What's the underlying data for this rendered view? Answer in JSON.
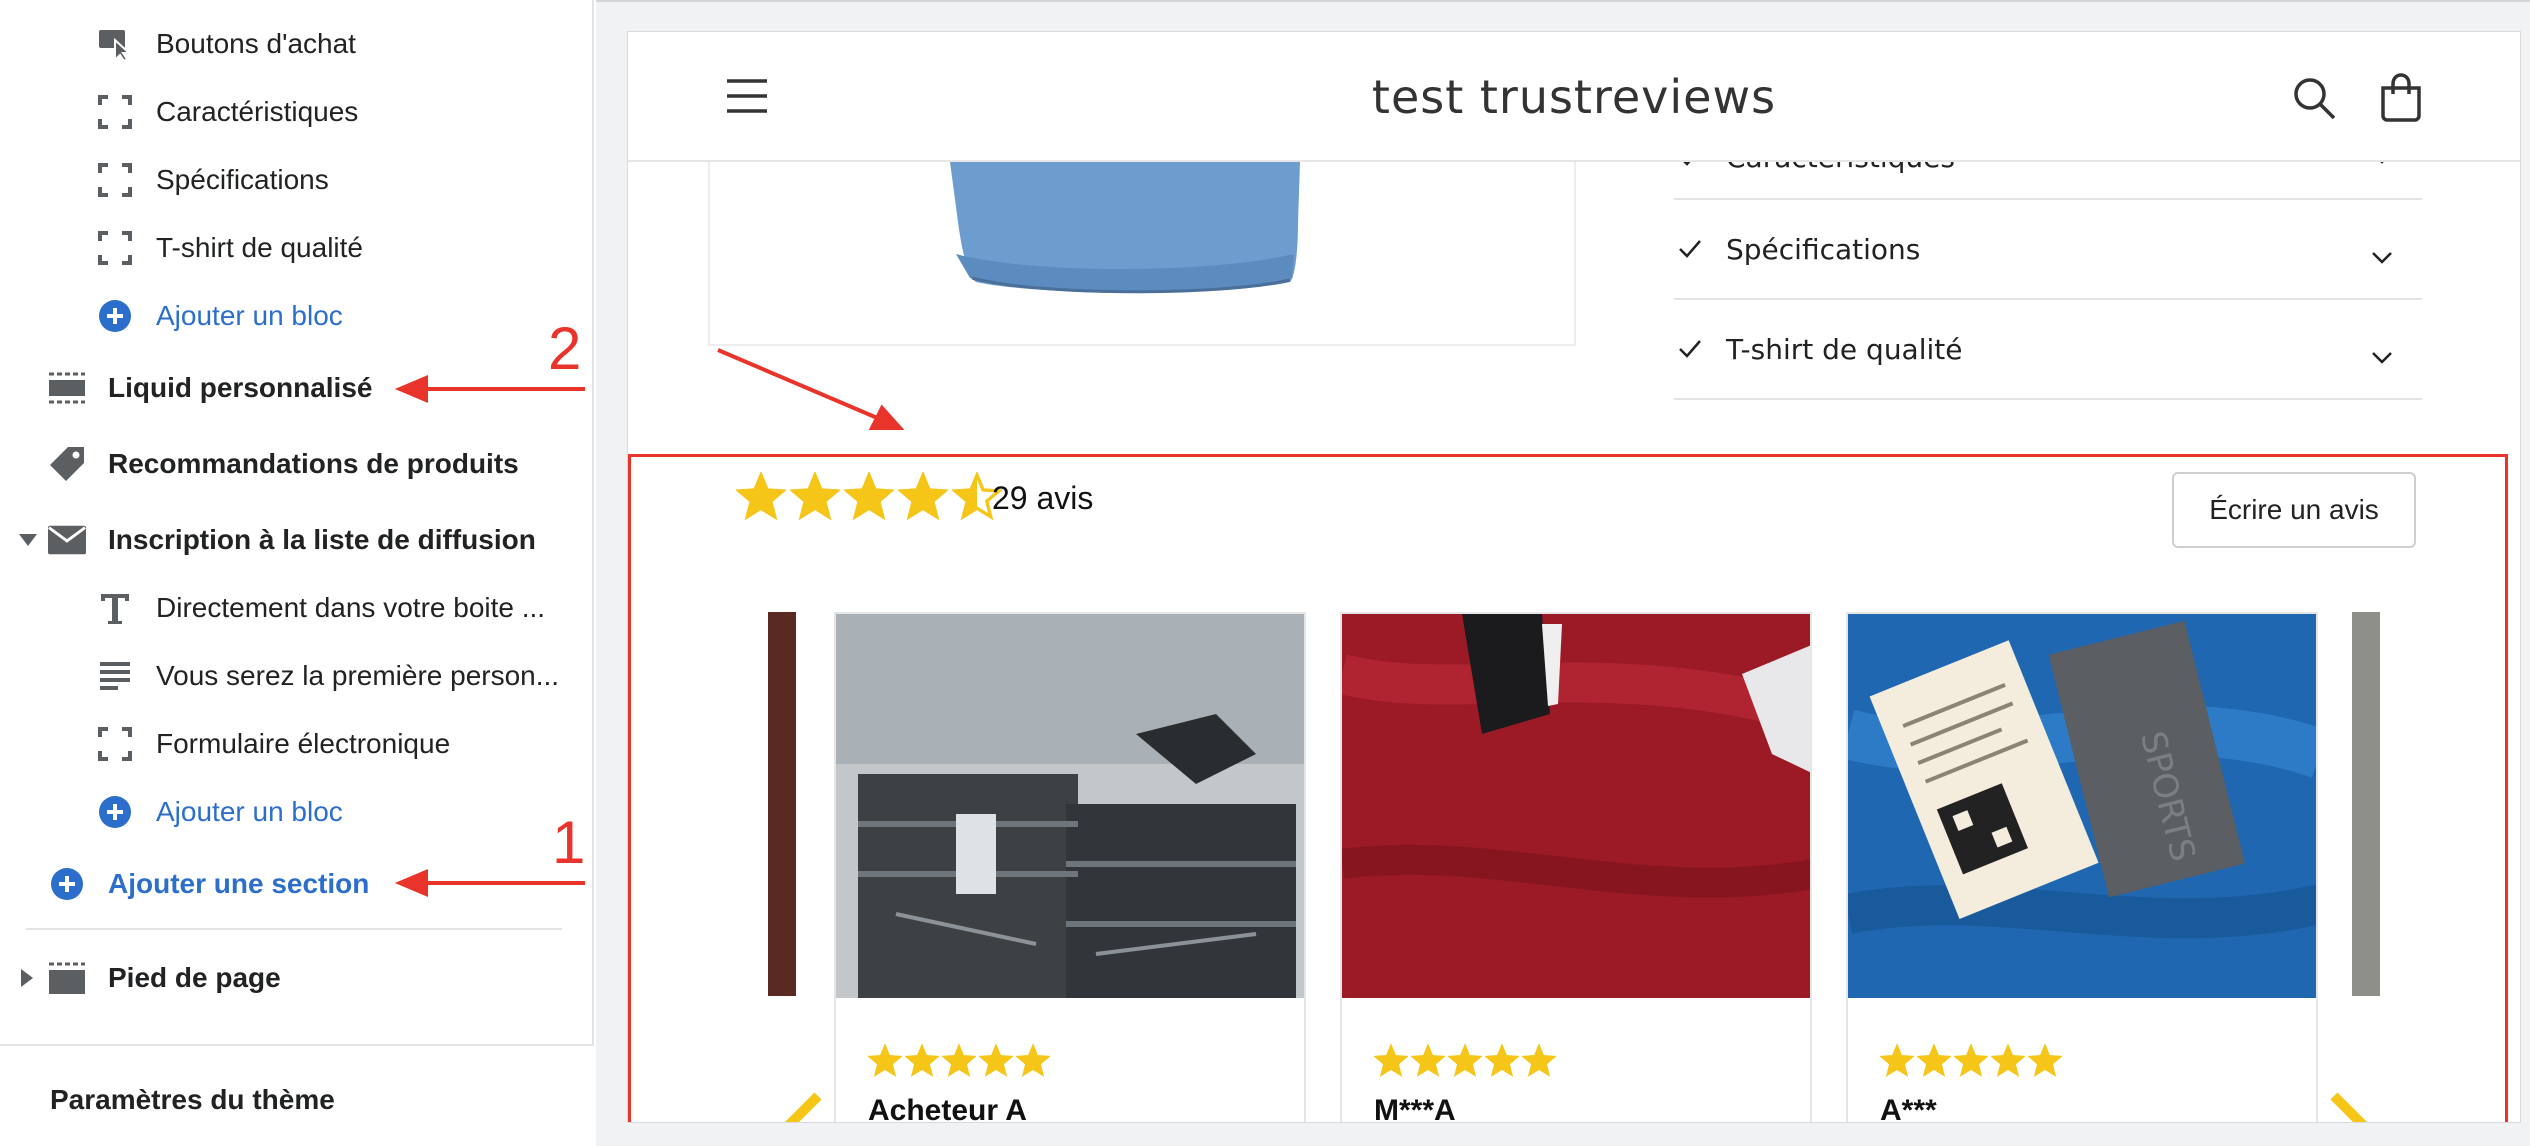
{
  "sidebar": {
    "items": [
      {
        "label": "Boutons d'achat",
        "icon": "cursor-click-icon"
      },
      {
        "label": "Caractéristiques",
        "icon": "dashed-square-icon"
      },
      {
        "label": "Spécifications",
        "icon": "dashed-square-icon"
      },
      {
        "label": "T-shirt de qualité",
        "icon": "dashed-square-icon"
      },
      {
        "label": "Ajouter un bloc",
        "icon": "plus-circle-icon"
      }
    ],
    "sections": [
      {
        "label": "Liquid personnalisé",
        "icon": "section-layout-icon"
      },
      {
        "label": "Recommandations de produits",
        "icon": "tag-icon"
      },
      {
        "label": "Inscription à la liste de diffusion",
        "icon": "envelope-icon"
      }
    ],
    "newsletter_blocks": [
      {
        "label": "Directement dans votre boite ...",
        "icon": "text-icon"
      },
      {
        "label": "Vous serez la première person...",
        "icon": "paragraph-icon"
      },
      {
        "label": "Formulaire électronique",
        "icon": "dashed-square-icon"
      },
      {
        "label": "Ajouter un bloc",
        "icon": "plus-circle-icon"
      }
    ],
    "add_section": "Ajouter une section",
    "footer_section": "Pied de page",
    "theme_settings": "Paramètres du thème"
  },
  "annotations": {
    "one": "1",
    "two": "2"
  },
  "store": {
    "title": "test trustreviews",
    "accordion": [
      "Caractéristiques",
      "Spécifications",
      "T-shirt de qualité"
    ]
  },
  "reviews": {
    "average_rating": 4.5,
    "count_label": "29 avis",
    "write_button": "Écrire un avis",
    "star_color": "#f5c518",
    "cards": [
      {
        "author": "Acheteur A",
        "rating": 5
      },
      {
        "author": "M***A",
        "rating": 5
      },
      {
        "author": "A***",
        "rating": 5
      }
    ]
  },
  "colors": {
    "link": "#2c6ecb",
    "annotation": "#e8342a",
    "card_red": "#9c1a26",
    "card_blue": "#1f67b0"
  }
}
